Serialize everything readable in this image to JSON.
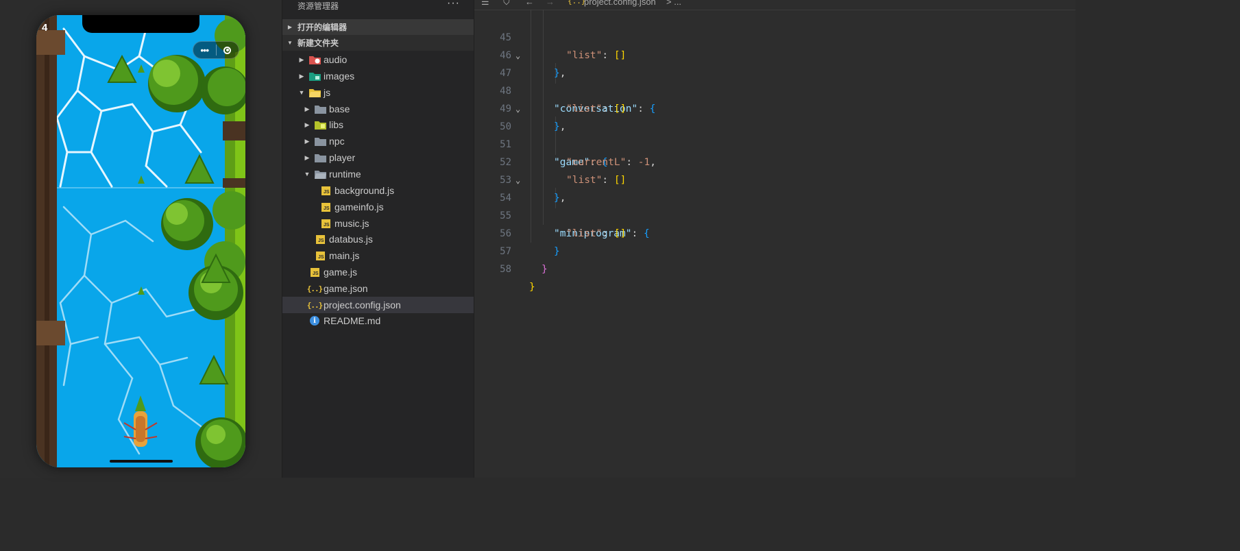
{
  "simulator": {
    "score": "4",
    "capsule_menu": "•••",
    "colors": {
      "water": "#09a6ea",
      "trunk": "#4a3322",
      "grass": "#7fc418"
    }
  },
  "explorer": {
    "title": "资源管理器",
    "more": "···",
    "open_editors": "打开的编辑器",
    "root_folder": "新建文件夹",
    "items": [
      {
        "label": "audio",
        "kind": "folder-audio",
        "depth": 0,
        "state": "collapsed"
      },
      {
        "label": "images",
        "kind": "folder-images",
        "depth": 0,
        "state": "collapsed"
      },
      {
        "label": "js",
        "kind": "folder-js",
        "depth": 0,
        "state": "expanded"
      },
      {
        "label": "base",
        "kind": "folder",
        "depth": 1,
        "state": "collapsed"
      },
      {
        "label": "libs",
        "kind": "folder-libs",
        "depth": 1,
        "state": "collapsed"
      },
      {
        "label": "npc",
        "kind": "folder",
        "depth": 1,
        "state": "collapsed"
      },
      {
        "label": "player",
        "kind": "folder",
        "depth": 1,
        "state": "collapsed"
      },
      {
        "label": "runtime",
        "kind": "folder-open",
        "depth": 1,
        "state": "expanded"
      },
      {
        "label": "background.js",
        "kind": "js",
        "depth": 2
      },
      {
        "label": "gameinfo.js",
        "kind": "js",
        "depth": 2
      },
      {
        "label": "music.js",
        "kind": "js",
        "depth": 2
      },
      {
        "label": "databus.js",
        "kind": "js",
        "depth": 1
      },
      {
        "label": "main.js",
        "kind": "js",
        "depth": 1
      },
      {
        "label": "game.js",
        "kind": "js",
        "depth": 0
      },
      {
        "label": "game.json",
        "kind": "json",
        "depth": 0
      },
      {
        "label": "project.config.json",
        "kind": "json",
        "depth": 0,
        "selected": true
      },
      {
        "label": "README.md",
        "kind": "info",
        "depth": 0
      }
    ]
  },
  "editor": {
    "breadcrumb_file": "project.config.json",
    "breadcrumb_rest": "> ...",
    "lines": [
      {
        "n": "45",
        "fold": false
      },
      {
        "n": "46",
        "fold": false
      },
      {
        "n": "47",
        "fold": true
      },
      {
        "n": "48",
        "fold": false
      },
      {
        "n": "49",
        "fold": false
      },
      {
        "n": "50",
        "fold": true
      },
      {
        "n": "51",
        "fold": false
      },
      {
        "n": "52",
        "fold": false
      },
      {
        "n": "53",
        "fold": false
      },
      {
        "n": "54",
        "fold": true
      },
      {
        "n": "55",
        "fold": false
      },
      {
        "n": "56",
        "fold": false
      },
      {
        "n": "57",
        "fold": false
      },
      {
        "n": "58",
        "fold": false
      }
    ],
    "tokens": {
      "list_key": "\"list\"",
      "conversation_key": "\"conversation\"",
      "game_key": "\"game\"",
      "currentL_key": "\"currentL\"",
      "miniprogram_key": "\"miniprogram\"",
      "colon": ": ",
      "empty_array": "[]",
      "open_brace": "{",
      "close_brace": "}",
      "close_brace_comma": "},",
      "comma": ",",
      "minus_one": "-1"
    }
  }
}
